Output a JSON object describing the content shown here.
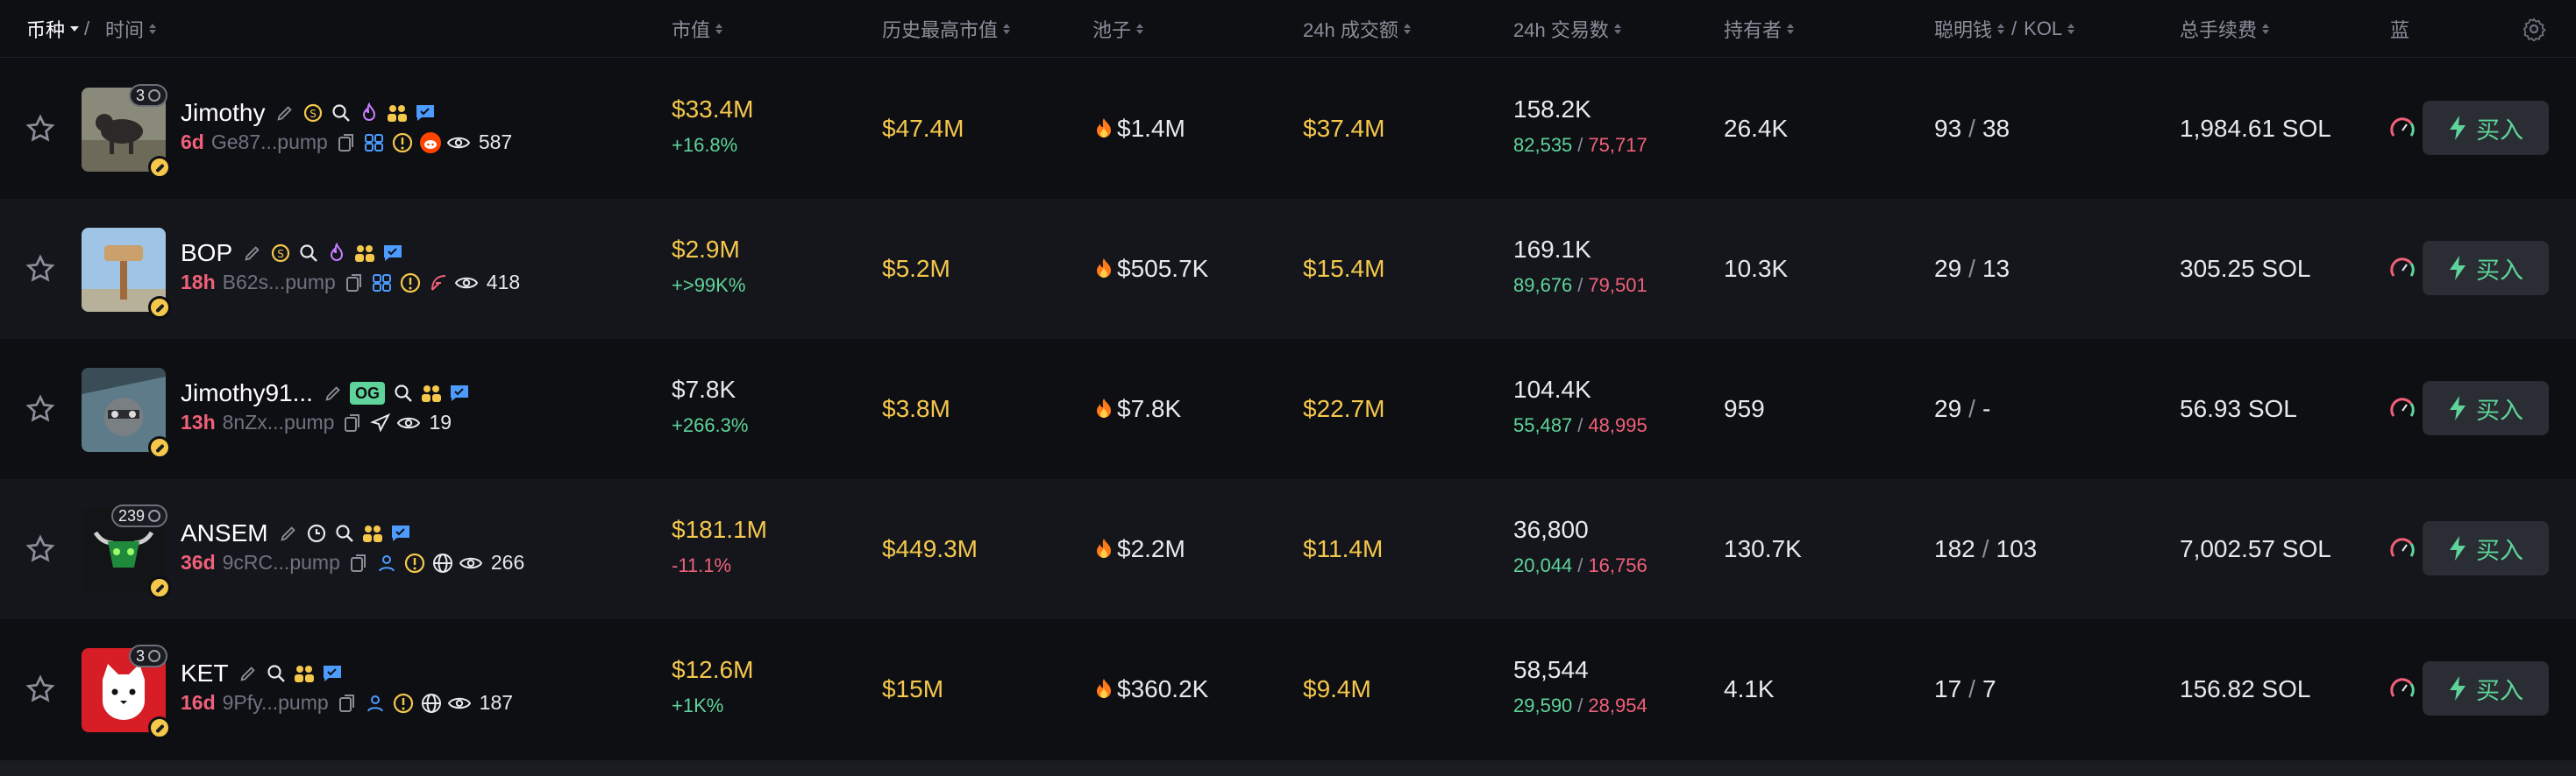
{
  "header": {
    "coin_label": "币种",
    "separator": "/",
    "time_label": "时间",
    "market_cap": "市值",
    "ath_market_cap": "历史最高市值",
    "pool": "池子",
    "volume_24h": "24h 成交额",
    "txns_24h": "24h 交易数",
    "holders": "持有者",
    "smart_money": "聪明钱",
    "kol_sep": "/",
    "kol": "KOL",
    "total_fees": "总手续费",
    "blue_chip": "蓝"
  },
  "rows": [
    {
      "name": "Jimothy",
      "badge_count": "3",
      "age": "6d",
      "address": "Ge87...pump",
      "views": "587",
      "market_cap": "$33.4M",
      "change": "+16.8%",
      "change_dir": "up",
      "ath": "$47.4M",
      "pool": "$1.4M",
      "volume": "$37.4M",
      "txns": "158.2K",
      "buys": "82,535",
      "sep": "/",
      "sells": "75,717",
      "holders": "26.4K",
      "smart": "93",
      "kol": "38",
      "fees": "1,984.61 SOL",
      "buy_label": "买入",
      "avatar": "dog-photo"
    },
    {
      "name": "BOP",
      "badge_count": "",
      "age": "18h",
      "address": "B62s...pump",
      "views": "418",
      "market_cap": "$2.9M",
      "change": "+>99K%",
      "change_dir": "up",
      "ath": "$5.2M",
      "pool": "$505.7K",
      "volume": "$15.4M",
      "txns": "169.1K",
      "buys": "89,676",
      "sep": "/",
      "sells": "79,501",
      "holders": "10.3K",
      "smart": "29",
      "kol": "13",
      "fees": "305.25 SOL",
      "buy_label": "买入",
      "avatar": "hammer-image"
    },
    {
      "name": "Jimothy91...",
      "badge_count": "",
      "og": "OG",
      "age": "13h",
      "address": "8nZx...pump",
      "views": "19",
      "market_cap": "$7.8K",
      "change": "+266.3%",
      "change_dir": "up",
      "ath": "$3.8M",
      "pool": "$7.8K",
      "volume": "$22.7M",
      "txns": "104.4K",
      "buys": "55,487",
      "sep": "/",
      "sells": "48,995",
      "holders": "959",
      "smart": "29",
      "kol": "-",
      "fees": "56.93 SOL",
      "buy_label": "买入",
      "avatar": "raccoon-image"
    },
    {
      "name": "ANSEM",
      "badge_count": "239",
      "age": "36d",
      "address": "9cRC...pump",
      "views": "266",
      "market_cap": "$181.1M",
      "change": "-11.1%",
      "change_dir": "down",
      "ath": "$449.3M",
      "pool": "$2.2M",
      "volume": "$11.4M",
      "txns": "36,800",
      "buys": "20,044",
      "sep": "/",
      "sells": "16,756",
      "holders": "130.7K",
      "smart": "182",
      "kol": "103",
      "fees": "7,002.57 SOL",
      "buy_label": "买入",
      "avatar": "bull-logo"
    },
    {
      "name": "KET",
      "badge_count": "3",
      "age": "16d",
      "address": "9Pfy...pump",
      "views": "187",
      "market_cap": "$12.6M",
      "change": "+1K%",
      "change_dir": "up",
      "ath": "$15M",
      "pool": "$360.2K",
      "volume": "$9.4M",
      "txns": "58,544",
      "buys": "29,590",
      "sep": "/",
      "sells": "28,954",
      "holders": "4.1K",
      "smart": "17",
      "kol": "7",
      "fees": "156.82 SOL",
      "buy_label": "买入",
      "avatar": "cat-logo"
    }
  ],
  "colors": {
    "yellow": "#f5c84c",
    "green": "#5fd49a",
    "red": "#f0607a",
    "row_alt": "#14161b",
    "bg": "#0e0f13"
  }
}
